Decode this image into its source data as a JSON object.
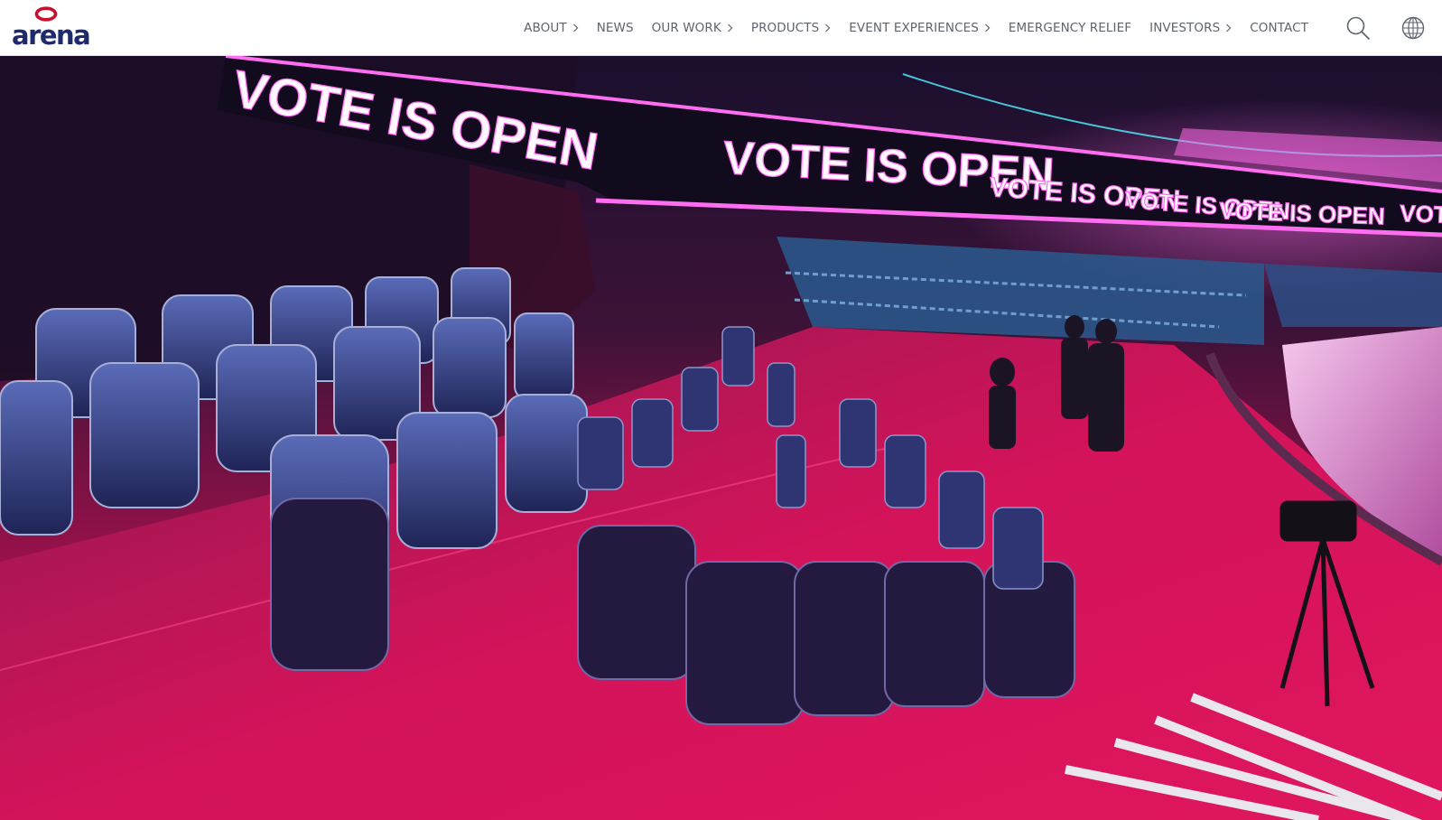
{
  "brand": {
    "name": "arena",
    "color": "#1e2a6b",
    "accent": "#c8102e"
  },
  "nav": {
    "items": [
      {
        "label": "ABOUT",
        "has_submenu": true
      },
      {
        "label": "NEWS",
        "has_submenu": false
      },
      {
        "label": "OUR WORK",
        "has_submenu": true
      },
      {
        "label": "PRODUCTS",
        "has_submenu": true
      },
      {
        "label": "EVENT EXPERIENCES",
        "has_submenu": true
      },
      {
        "label": "EMERGENCY RELIEF",
        "has_submenu": false
      },
      {
        "label": "INVESTORS",
        "has_submenu": true
      },
      {
        "label": "CONTACT",
        "has_submenu": false
      }
    ],
    "text_color": "#5d6470",
    "icons": [
      "search-icon",
      "globe-icon"
    ]
  },
  "hero": {
    "signage": [
      "VOTE IS OPEN",
      "VOTE IS OPEN",
      "VOTE IS OPEN",
      "VOTE IS OPEN",
      "VOTE IS OPEN",
      "VOTE IS OPEN"
    ],
    "palette": {
      "seat": "#3d4a8f",
      "carpet": "#d4165a",
      "neon": "#ff5fe0"
    }
  }
}
